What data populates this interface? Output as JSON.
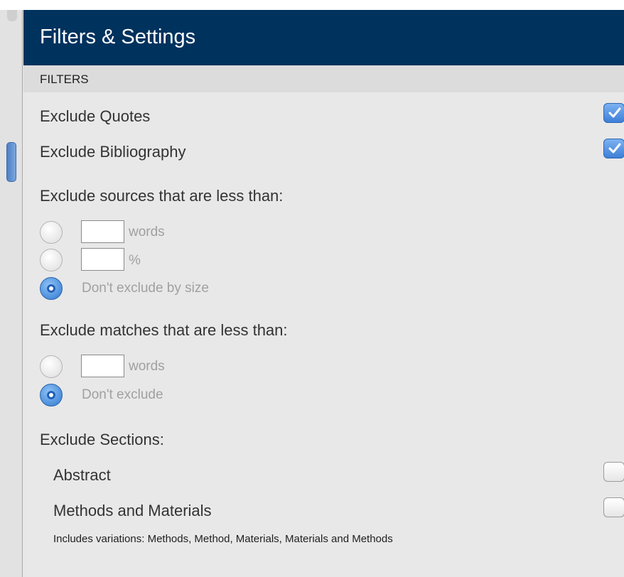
{
  "header": {
    "title": "Filters & Settings"
  },
  "filters_section": {
    "label": "FILTERS"
  },
  "exclude_quotes": {
    "label": "Exclude Quotes",
    "checked": true
  },
  "exclude_bibliography": {
    "label": "Exclude Bibliography",
    "checked": true
  },
  "exclude_sources": {
    "heading": "Exclude sources that are less than:",
    "options": [
      {
        "selected": false,
        "value": "",
        "unit": "words"
      },
      {
        "selected": false,
        "value": "",
        "unit": "%"
      },
      {
        "selected": true,
        "label": "Don't exclude by size"
      }
    ]
  },
  "exclude_matches": {
    "heading": "Exclude matches that are less than:",
    "options": [
      {
        "selected": false,
        "value": "",
        "unit": "words"
      },
      {
        "selected": true,
        "label": "Don't exclude"
      }
    ]
  },
  "exclude_sections": {
    "heading": "Exclude Sections:",
    "items": [
      {
        "label": "Abstract",
        "checked": false
      },
      {
        "label": "Methods and Materials",
        "checked": false
      }
    ],
    "note": "Includes variations: Methods, Method, Materials, Materials and Methods"
  },
  "colors": {
    "header_bg": "#00325e",
    "accent_blue": "#3d7fd8",
    "panel_bg": "#e8e8e8"
  }
}
